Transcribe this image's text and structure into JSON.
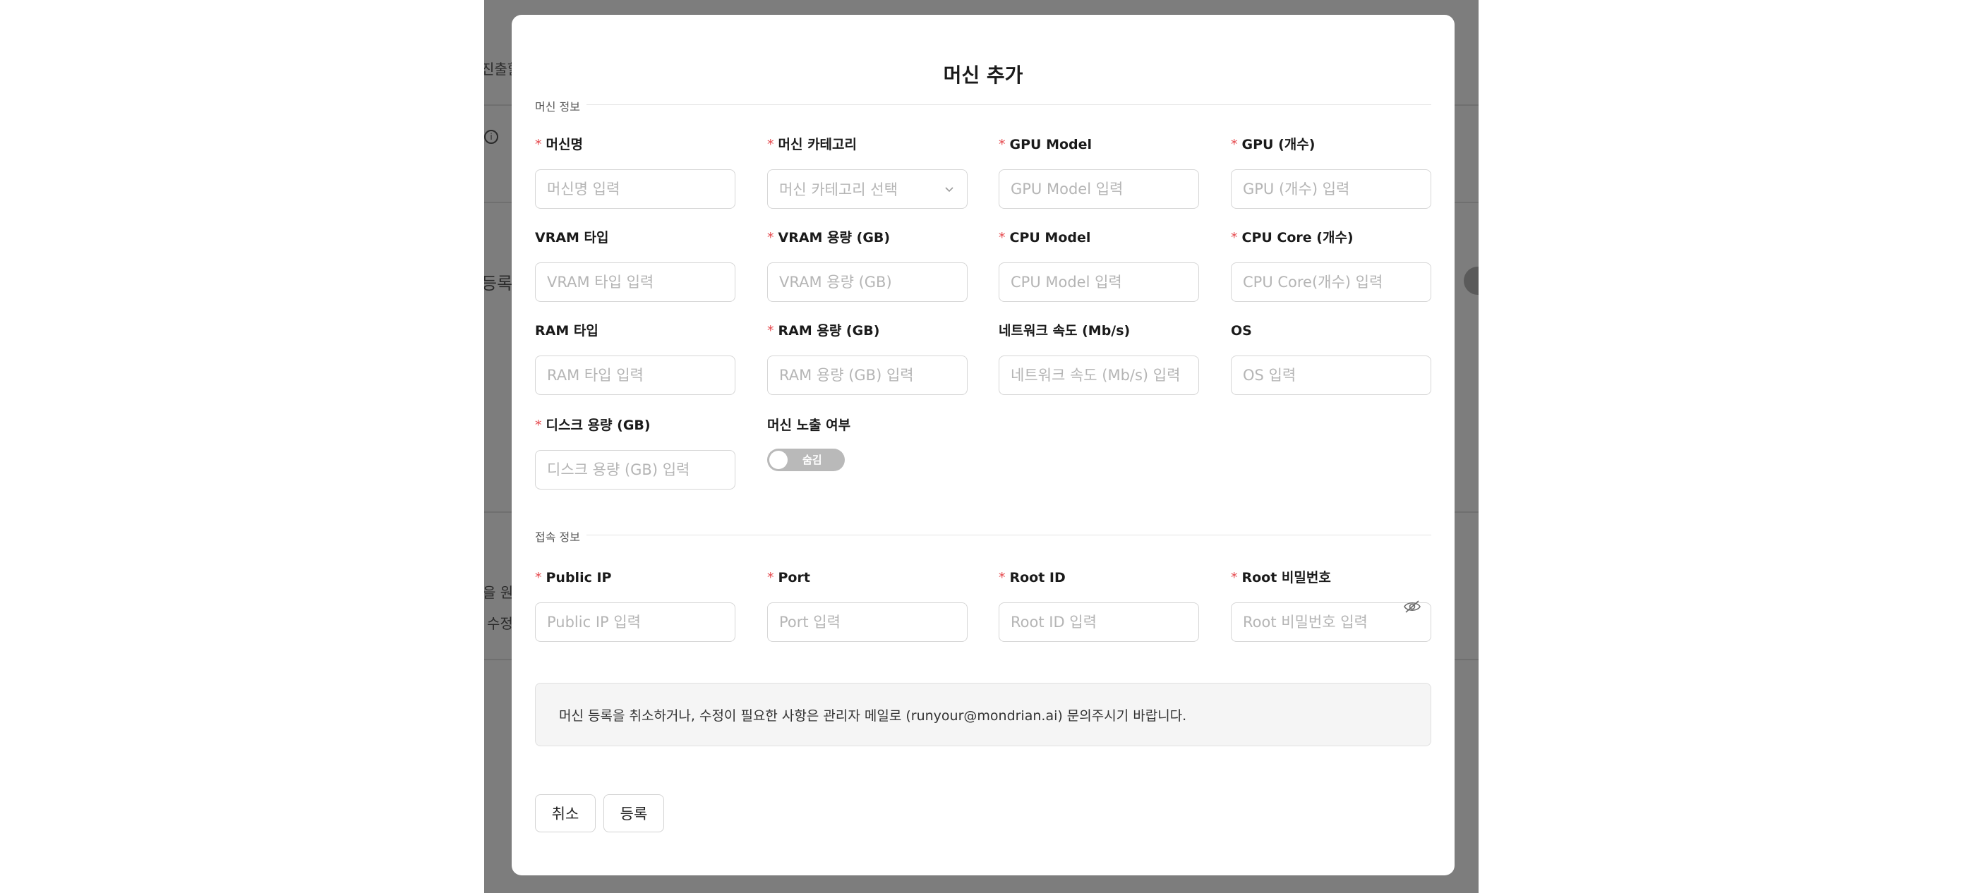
{
  "background": {
    "fragments": [
      "진출할",
      "i",
      "등록",
      "을 원",
      "수정"
    ]
  },
  "modal": {
    "title": "머신 추가",
    "sections": {
      "machine_info": "머신 정보",
      "connection_info": "접속 정보"
    },
    "fields": {
      "machine_name": {
        "label": "머신명",
        "placeholder": "머신명 입력",
        "required": true
      },
      "machine_category": {
        "label": "머신 카테고리",
        "placeholder": "머신 카테고리 선택",
        "required": true
      },
      "gpu_model": {
        "label": "GPU Model",
        "placeholder": "GPU Model 입력",
        "required": true
      },
      "gpu_count": {
        "label": "GPU (개수)",
        "placeholder": "GPU (개수) 입력",
        "required": true
      },
      "vram_type": {
        "label": "VRAM 타입",
        "placeholder": "VRAM 타입 입력",
        "required": false
      },
      "vram_capacity": {
        "label": "VRAM 용량 (GB)",
        "placeholder": "VRAM 용량 (GB)",
        "required": true
      },
      "cpu_model": {
        "label": "CPU Model",
        "placeholder": "CPU Model 입력",
        "required": true
      },
      "cpu_core": {
        "label": "CPU Core (개수)",
        "placeholder": "CPU Core(개수) 입력",
        "required": true
      },
      "ram_type": {
        "label": "RAM 타입",
        "placeholder": "RAM 타입 입력",
        "required": false
      },
      "ram_capacity": {
        "label": "RAM 용량 (GB)",
        "placeholder": "RAM 용량 (GB) 입력",
        "required": true
      },
      "network_speed": {
        "label": "네트워크 속도 (Mb/s)",
        "placeholder": "네트워크 속도 (Mb/s) 입력",
        "required": false
      },
      "os": {
        "label": "OS",
        "placeholder": "OS 입력",
        "required": false
      },
      "disk_capacity": {
        "label": "디스크 용량 (GB)",
        "placeholder": "디스크 용량 (GB) 입력",
        "required": true
      },
      "machine_visibility": {
        "label": "머신 노출 여부",
        "toggle_text": "숨김",
        "state": "off"
      },
      "public_ip": {
        "label": "Public IP",
        "placeholder": "Public IP 입력",
        "required": true
      },
      "port": {
        "label": "Port",
        "placeholder": "Port 입력",
        "required": true
      },
      "root_id": {
        "label": "Root ID",
        "placeholder": "Root ID 입력",
        "required": true
      },
      "root_password": {
        "label": "Root 비밀번호",
        "placeholder": "Root 비밀번호 입력",
        "required": true
      }
    },
    "required_mark": "*",
    "notice": "머신 등록을 취소하거나, 수정이 필요한 사항은 관리자 메일로 (runyour@mondrian.ai) 문의주시기 바랍니다.",
    "buttons": {
      "cancel": "취소",
      "submit": "등록"
    }
  },
  "colors": {
    "overlay": "#7d7d7d",
    "required": "#e5484d",
    "toggle_off": "#b9b9b9"
  }
}
